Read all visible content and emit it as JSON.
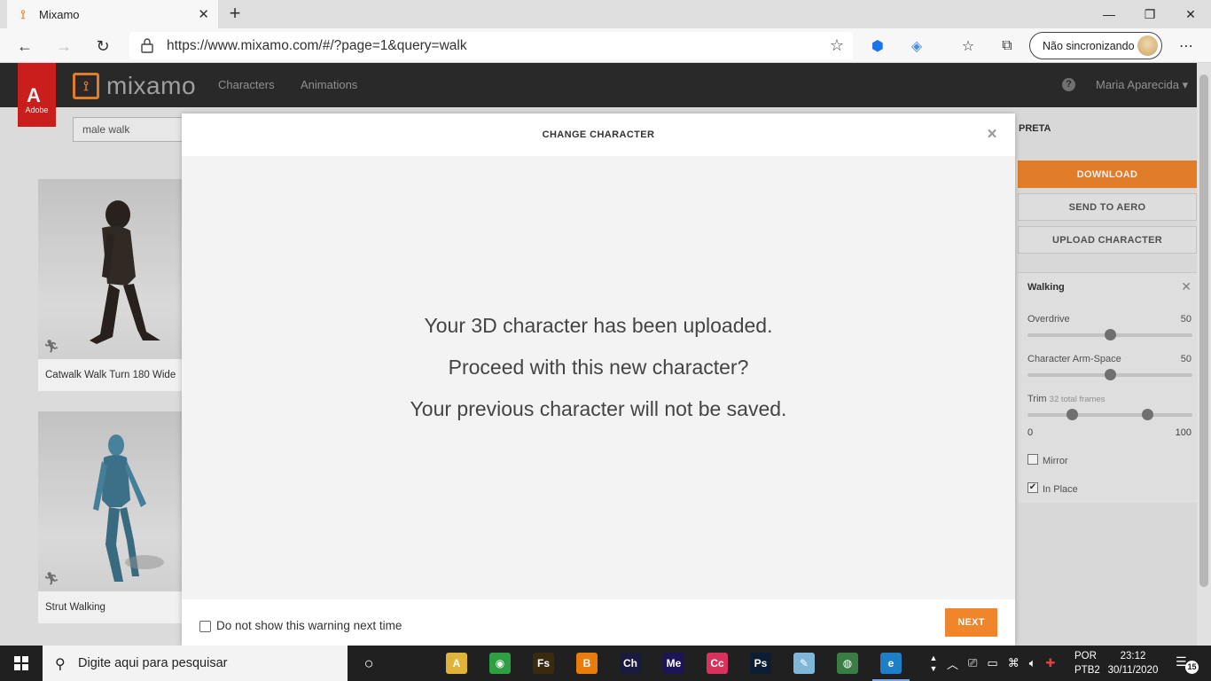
{
  "browser": {
    "tab_title": "Mixamo",
    "url": "https://www.mixamo.com/#/?page=1&query=walk",
    "profile_label": "Não sincronizando"
  },
  "mixamo": {
    "brand": "mixamo",
    "adobe_label": "Adobe",
    "nav": [
      "Characters",
      "Animations"
    ],
    "user_name": "Maria Aparecida",
    "search_value": "male walk",
    "cards": [
      {
        "label": "Catwalk Walk Turn 180 Wide"
      },
      {
        "label": "Strut Walking"
      }
    ],
    "right_panel": {
      "character_name_fragment": "PRETA",
      "download_label": "DOWNLOAD",
      "send_label": "SEND TO AERO",
      "upload_label": "UPLOAD CHARACTER",
      "animation_name": "Walking",
      "params": [
        {
          "label": "Overdrive",
          "value": "50",
          "level": 0.5
        },
        {
          "label": "Character Arm-Space",
          "value": "50",
          "level": 0.5
        }
      ],
      "trim": {
        "label": "Trim",
        "sublabel": "32 total frames",
        "min": "0",
        "max": "100",
        "start": 0.27,
        "end": 0.73
      },
      "mirror_label": "Mirror",
      "mirror_checked": false,
      "in_place_label": "In Place",
      "in_place_checked": true
    }
  },
  "modal": {
    "title": "CHANGE CHARACTER",
    "lines": [
      "Your 3D character has been uploaded.",
      "Proceed with this new character?",
      "Your previous character will not be saved."
    ],
    "checkbox_label": "Do not show this warning next time",
    "next_label": "NEXT"
  },
  "taskbar": {
    "search_placeholder": "Digite aqui para pesquisar",
    "apps": [
      {
        "name": "task-view-icon",
        "label": "",
        "color": "#202020"
      },
      {
        "name": "android-icon",
        "label": "A",
        "color": "#e0b43a"
      },
      {
        "name": "maps-icon",
        "label": "◉",
        "color": "#2ea043"
      },
      {
        "name": "fuse-icon",
        "label": "Fs",
        "color": "#3a2a10"
      },
      {
        "name": "blender-icon",
        "label": "B",
        "color": "#e87d0d"
      },
      {
        "name": "character-animator-icon",
        "label": "Ch",
        "color": "#1b1a3f"
      },
      {
        "name": "media-encoder-icon",
        "label": "Me",
        "color": "#1e1556"
      },
      {
        "name": "creative-cloud-icon",
        "label": "Cc",
        "color": "#d8315b"
      },
      {
        "name": "photoshop-icon",
        "label": "Ps",
        "color": "#0d1d33"
      },
      {
        "name": "notes-icon",
        "label": "✎",
        "color": "#7fb7d8"
      },
      {
        "name": "chrome-icon",
        "label": "◍",
        "color": "#3a7d44"
      },
      {
        "name": "edge-icon",
        "label": "e",
        "color": "#1e7fc9"
      }
    ],
    "lang_top": "POR",
    "lang_bottom": "PTB2",
    "time": "23:12",
    "date": "30/11/2020",
    "notifications_count": "15"
  }
}
